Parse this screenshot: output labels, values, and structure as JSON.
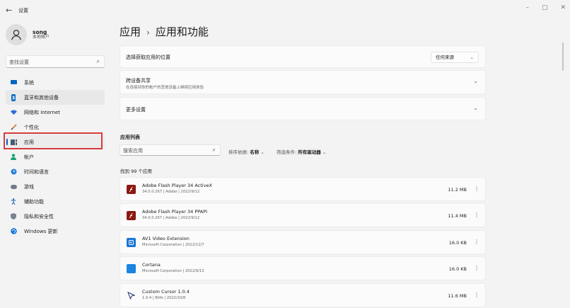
{
  "window": {
    "title": "设置",
    "back_glyph": "←",
    "minimize_glyph": "–",
    "restore_glyph": "▢",
    "close_glyph": "✕"
  },
  "profile": {
    "name": "song",
    "subtitle": "本地帐户"
  },
  "sidebar": {
    "search_placeholder": "查找设置",
    "items": [
      {
        "label": "系统",
        "icon": "monitor-icon",
        "color": "#0067c0"
      },
      {
        "label": "蓝牙和其他设备",
        "icon": "bluetooth-icon",
        "color": "#0067c0"
      },
      {
        "label": "网络和 Internet",
        "icon": "wifi-icon",
        "color": "#2a6fd6"
      },
      {
        "label": "个性化",
        "icon": "brush-icon",
        "color": "#c77a2b"
      },
      {
        "label": "应用",
        "icon": "apps-icon",
        "color": "#4a5a6f"
      },
      {
        "label": "帐户",
        "icon": "account-icon",
        "color": "#1aa37a"
      },
      {
        "label": "时间和语言",
        "icon": "globe-clock-icon",
        "color": "#2a7fd6"
      },
      {
        "label": "游戏",
        "icon": "gamepad-icon",
        "color": "#6f7b88"
      },
      {
        "label": "辅助功能",
        "icon": "accessibility-icon",
        "color": "#1d5fbf"
      },
      {
        "label": "隐私和安全性",
        "icon": "shield-icon",
        "color": "#7a8290"
      },
      {
        "label": "Windows 更新",
        "icon": "update-icon",
        "color": "#0a6fd6"
      }
    ]
  },
  "main": {
    "breadcrumb_parent": "应用",
    "breadcrumb_sep": "›",
    "breadcrumb_current": "应用和功能",
    "source_card": {
      "title": "选择获取应用的位置",
      "select_value": "任何来源"
    },
    "share_card": {
      "title": "跨设备共享",
      "subtitle": "在连接到你的帐户的其他设备上继续应用体验"
    },
    "more_card": {
      "title": "更多设置"
    },
    "app_list_label": "应用列表",
    "app_search_placeholder": "搜索应用",
    "sort_label": "排序依据:",
    "sort_value": "名称",
    "filter_label": "筛选条件:",
    "filter_value": "所有驱动器",
    "found_text": "找到 99 个应用",
    "apps": [
      {
        "name": "Adobe Flash Player 34 ActiveX",
        "meta": "34.0.0.267 | Adobe | 2022/9/12",
        "size": "11.2 MB",
        "icon": "flash-icon",
        "color": "#8c1a12"
      },
      {
        "name": "Adobe Flash Player 34 PPAPI",
        "meta": "34.0.0.267 | Adobe | 2022/9/12",
        "size": "11.4 MB",
        "icon": "flash-icon",
        "color": "#8c1a12"
      },
      {
        "name": "AV1 Video Extension",
        "meta": "Microsoft Corporation | 2022/12/7",
        "size": "16.0 KB",
        "icon": "av1-icon",
        "color": "#1a74d6"
      },
      {
        "name": "Cortana",
        "meta": "Microsoft Corporation | 2022/9/13",
        "size": "16.0 KB",
        "icon": "cortana-icon",
        "color": "#1a84e0"
      },
      {
        "name": "Custom Cursor 1.0.4",
        "meta": "1.0.4 | Blife | 2022/10/8",
        "size": "11.6 MB",
        "icon": "cursor-icon",
        "color": "#1e2d6b"
      }
    ]
  }
}
